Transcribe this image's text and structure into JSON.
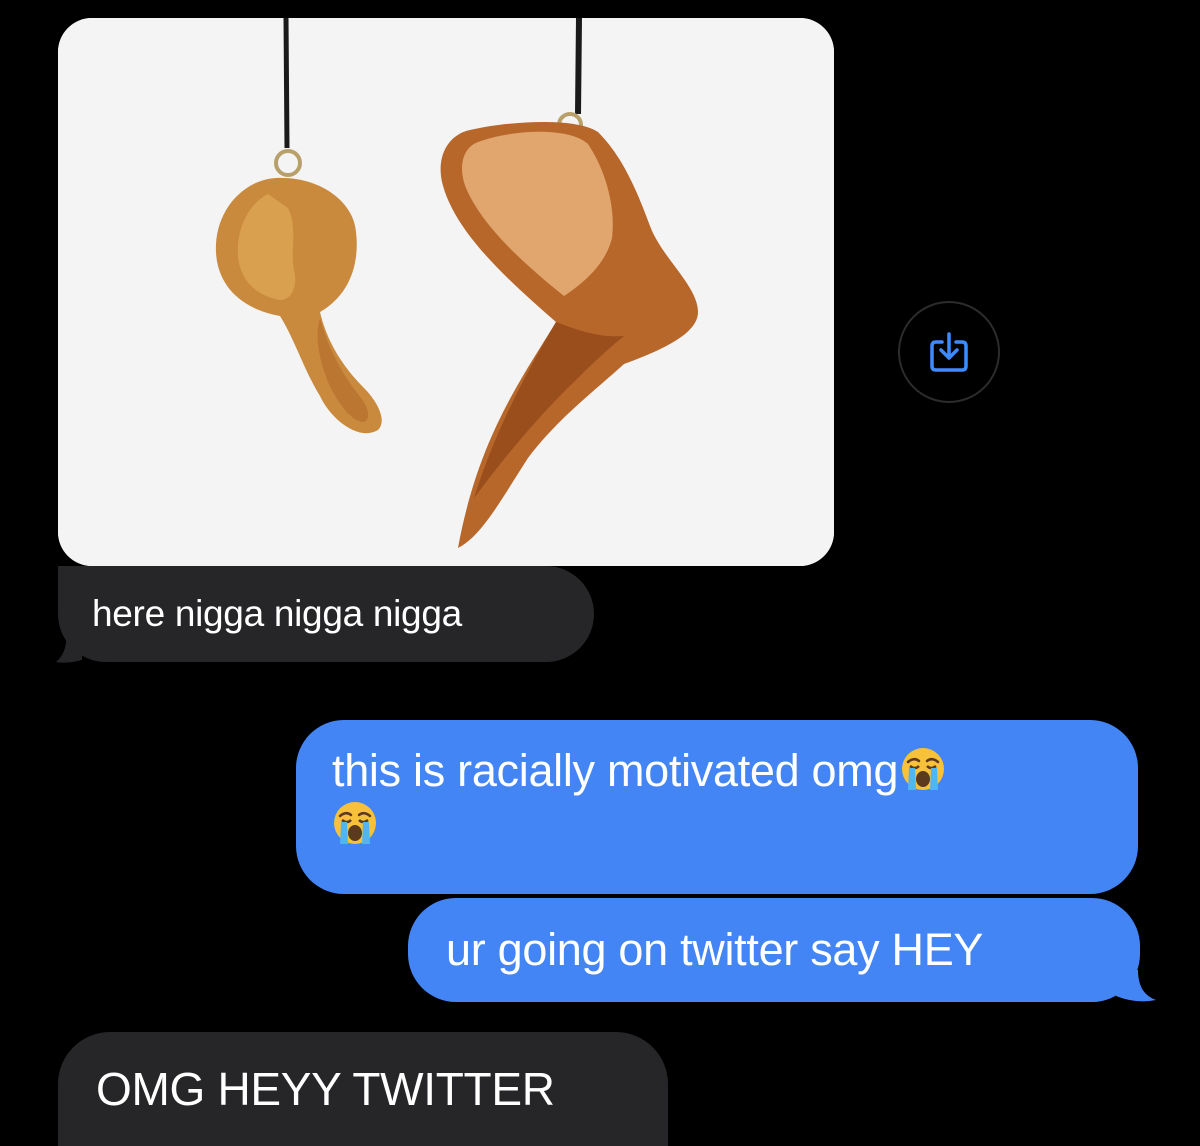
{
  "thread": {
    "attachment": {
      "kind": "photo",
      "icons": {
        "save": "save-download-icon"
      }
    },
    "messages": [
      {
        "from": "received",
        "text": "here nigga nigga nigga"
      },
      {
        "from": "sent",
        "text": "this is racially motivated omg",
        "emoji": [
          "loudly-crying-face-icon",
          "loudly-crying-face-icon"
        ]
      },
      {
        "from": "sent",
        "text": "ur going on twitter say HEY"
      },
      {
        "from": "received",
        "text": "OMG HEYY TWITTER"
      }
    ]
  },
  "colors": {
    "background": "#000000",
    "received_bubble": "#262628",
    "sent_bubble": "#4385f5",
    "text": "#ffffff",
    "save_icon": "#3d8bff"
  }
}
